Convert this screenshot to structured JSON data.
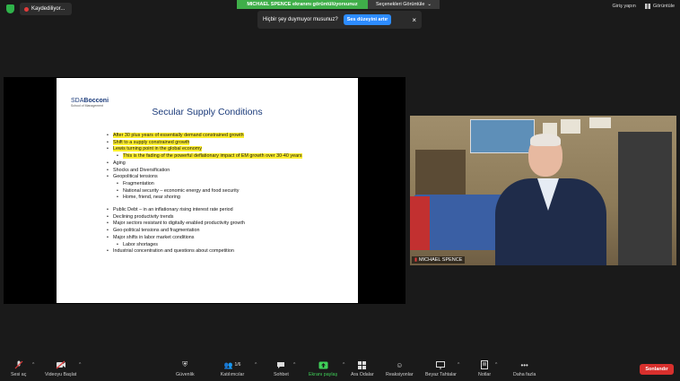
{
  "topbar": {
    "recording_label": "Kaydediliyor...",
    "share_banner": "MICHAEL SPENCE ekranını görüntülüyorsunuz",
    "view_options": "Seçenekleri Görüntüle",
    "notice_text": "Hiçbir şey duymuyor musunuz?",
    "notice_button": "Ses düzeyini artır",
    "notice_close": "×",
    "exit_label": "Giriş yapın",
    "view_label": "Görüntüle"
  },
  "slide": {
    "logo_main_prefix": "SDA",
    "logo_main": "Bocconi",
    "logo_sub": "School of Management",
    "title": "Secular Supply Conditions",
    "bullets": [
      {
        "text": "After 30 plus years of essentially demand constrained growth",
        "level": 0,
        "hl": true
      },
      {
        "text": "Shift to a supply constrained growth",
        "level": 0,
        "hl": true
      },
      {
        "text": "Lewis turning point in the global economy",
        "level": 0,
        "hl": true
      },
      {
        "text": "This is the fading of the powerful deflationary impact of EM growth over 30-40 years",
        "level": 1,
        "hl": true
      },
      {
        "text": "Aging",
        "level": 0,
        "hl": false
      },
      {
        "text": "Shocks and Diversification",
        "level": 0,
        "hl": false
      },
      {
        "text": "Geopolitical tensions",
        "level": 0,
        "hl": false
      },
      {
        "text": "Fragmentation",
        "level": 1,
        "hl": false
      },
      {
        "text": "National security – economic energy and food security",
        "level": 1,
        "hl": false
      },
      {
        "text": "Home, friend, near shoring",
        "level": 1,
        "hl": false
      },
      {
        "text": "Public Debt – in an inflationary rising interest rate period",
        "level": 0,
        "hl": false,
        "gap": true
      },
      {
        "text": "Declining productivity trends",
        "level": 0,
        "hl": false
      },
      {
        "text": "Major sectors resistant to digitally enabled productivity growth",
        "level": 0,
        "hl": false
      },
      {
        "text": "Geo-political tensions and fragmentation",
        "level": 0,
        "hl": false
      },
      {
        "text": "Major shifts in labor market conditions",
        "level": 0,
        "hl": false
      },
      {
        "text": "Labor shortages",
        "level": 1,
        "hl": false
      },
      {
        "text": "Industrial concentration and questions about competition",
        "level": 0,
        "hl": false
      }
    ]
  },
  "video": {
    "participant_name": "MICHAEL SPENCE"
  },
  "toolbar": {
    "audio": "Sesi aç",
    "video": "Videoyu Başlat",
    "security": "Güvenlik",
    "participants": "Katılımcılar",
    "participants_count": "1/6",
    "chat": "Sohbet",
    "share": "Ekranı paylaş",
    "breakout": "Ara Odalar",
    "reactions": "Reaksiyonlar",
    "whiteboards": "Beyaz Tahtalar",
    "notes": "Notlar",
    "more": "Daha fazla",
    "end": "Sonlandır"
  },
  "colors": {
    "accent": "#2d8cff",
    "share_green": "#3fae49",
    "end_red": "#d8302d",
    "highlight": "#ffef2e"
  }
}
